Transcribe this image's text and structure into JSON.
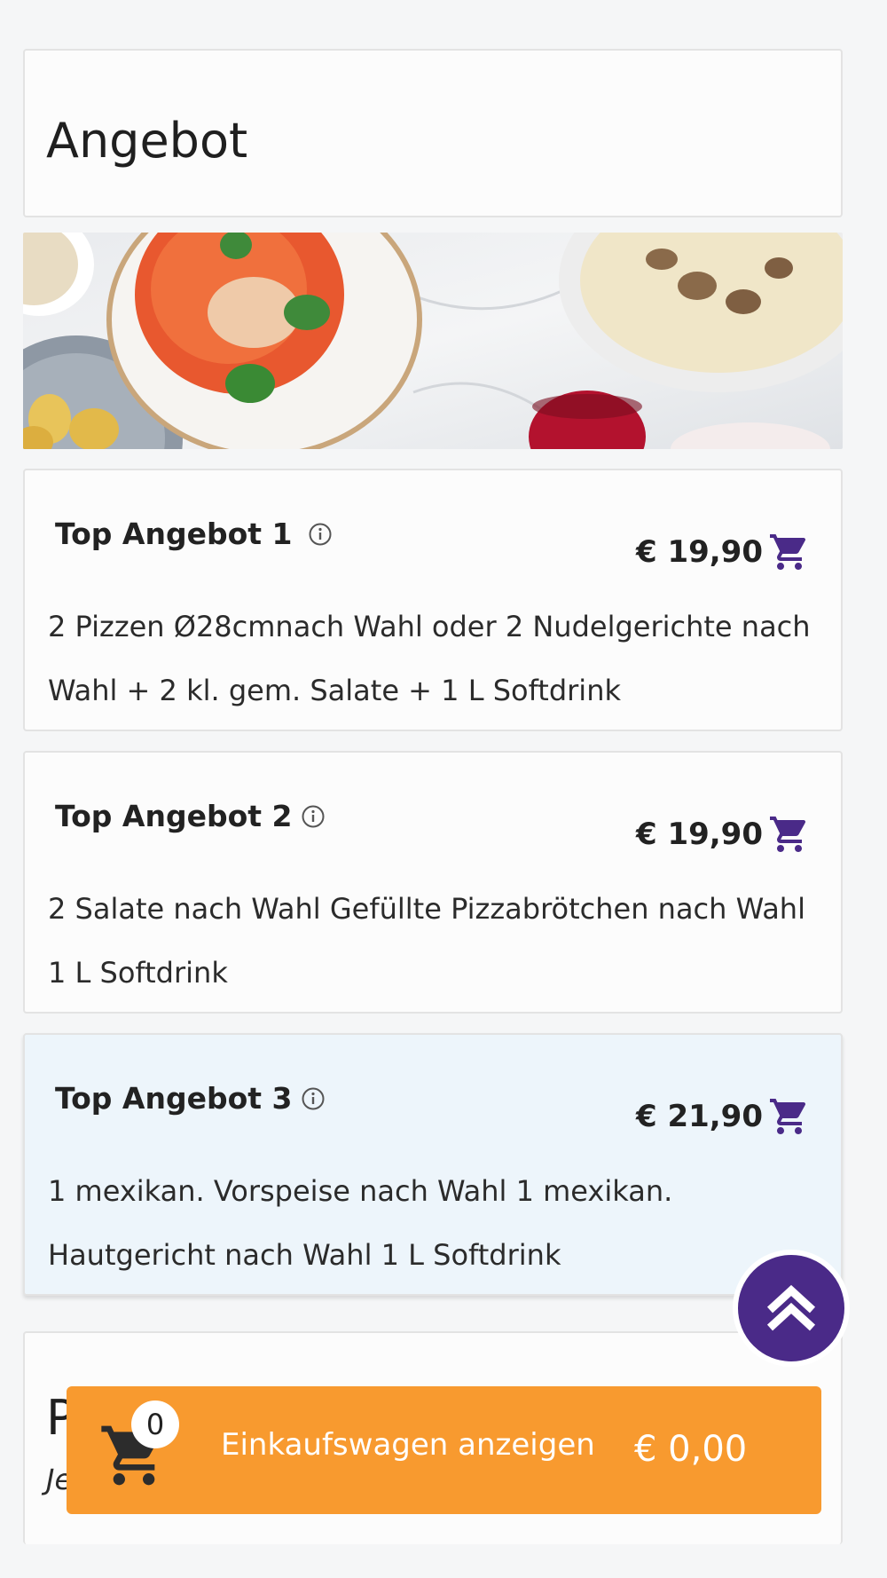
{
  "section": {
    "title": "Angebot"
  },
  "banner": {
    "image": "food-banner-image"
  },
  "offers": [
    {
      "name": "Top Angebot 1",
      "price": "€ 19,90",
      "description": "2 Pizzen Ø28cmnach Wahl oder 2 Nudelgerichte nach Wahl + 2 kl. gem. Salate + 1 L Softdrink"
    },
    {
      "name": "Top Angebot 2",
      "price": "€ 19,90",
      "description": "2 Salate nach Wahl Gefüllte Pizzabrötchen nach Wahl 1 L Softdrink"
    },
    {
      "name": "Top Angebot 3",
      "price": "€ 21,90",
      "description": "1 mexikan. Vorspeise nach Wahl 1 mexikan. Hautgericht nach Wahl 1 L Softdrink"
    }
  ],
  "next_section": {
    "title_fragment": "P",
    "subtitle_fragment": "Je"
  },
  "cart": {
    "count": "0",
    "label": "Einkaufswagen anzeigen",
    "total": "€ 0,00"
  },
  "icons": {
    "info": "info-icon",
    "cart": "shopping-cart-icon",
    "scroll_top": "double-chevron-up-icon"
  },
  "colors": {
    "accent": "#4a2a88",
    "cart_bar": "#f89a2f",
    "highlight": "#edf5fb"
  }
}
